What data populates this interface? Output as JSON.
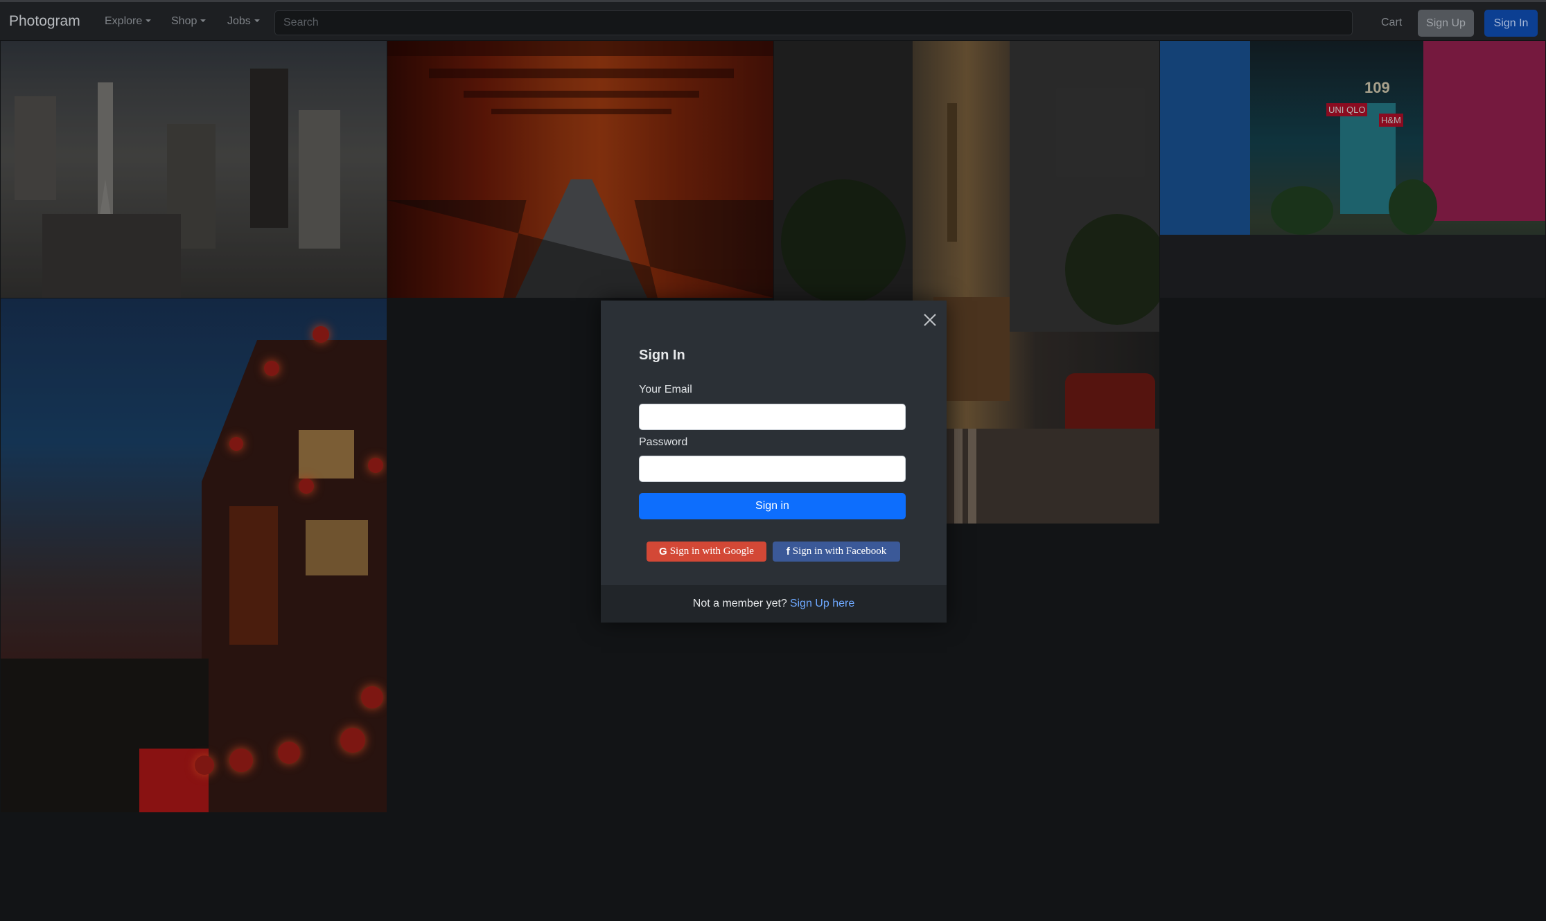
{
  "navbar": {
    "brand": "Photogram",
    "menus": [
      {
        "label": "Explore"
      },
      {
        "label": "Shop"
      },
      {
        "label": "Jobs"
      }
    ],
    "search_placeholder": "Search",
    "cart_label": "Cart",
    "signup_label": "Sign Up",
    "signin_label": "Sign In"
  },
  "gallery": {
    "photo_signs": [
      "UNI QLO",
      "H&M",
      "109"
    ]
  },
  "modal": {
    "title": "Sign In",
    "email_label": "Your Email",
    "email_value": "",
    "password_label": "Password",
    "password_value": "",
    "submit_label": "Sign in",
    "google_label": "Sign in with Google",
    "facebook_label": "Sign in with Facebook",
    "footer_text": "Not a member yet?",
    "footer_link": "Sign Up here"
  },
  "colors": {
    "background": "#121416",
    "navbar": "#1d1f22",
    "primary": "#0d6efd",
    "google": "#d34836",
    "facebook": "#3b5998",
    "link": "#6ea8fe",
    "modal": "#2b3036"
  },
  "icons": {
    "close": "close-icon",
    "google": "google-icon",
    "facebook": "facebook-icon",
    "caret": "caret-down-icon"
  }
}
